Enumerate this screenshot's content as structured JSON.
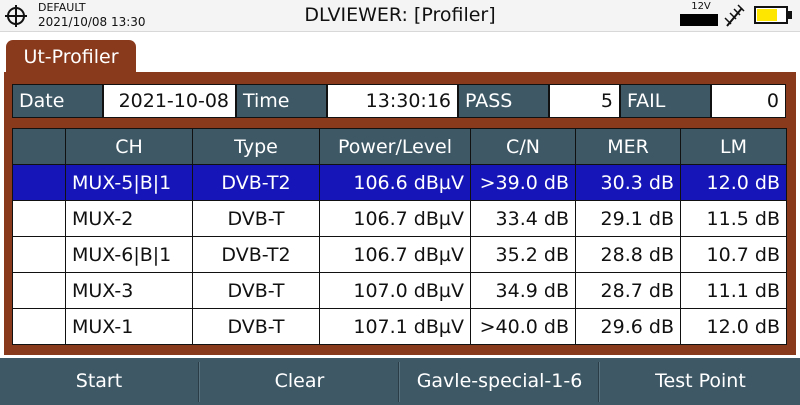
{
  "status": {
    "profile": "DEFAULT",
    "datetime": "2021/10/08 13:30",
    "title": "DLVIEWER: [Profiler]",
    "voltage": "12V",
    "icons": [
      "crosshair-icon",
      "antenna-icon",
      "battery-icon"
    ],
    "battery_level": 0.65
  },
  "tab": {
    "label": "Ut-Profiler"
  },
  "info": {
    "date_label": "Date",
    "date_value": "2021-10-08",
    "time_label": "Time",
    "time_value": "13:30:16",
    "pass_label": "PASS",
    "pass_value": "5",
    "fail_label": "FAIL",
    "fail_value": "0"
  },
  "table": {
    "headers": [
      "",
      "CH",
      "Type",
      "Power/Level",
      "C/N",
      "MER",
      "LM"
    ],
    "rows": [
      {
        "ch": "MUX-5|B|1",
        "type": "DVB-T2",
        "power": "106.6 dBµV",
        "cn": ">39.0 dB",
        "mer": "30.3 dB",
        "lm": "12.0 dB",
        "selected": true
      },
      {
        "ch": "MUX-2",
        "type": "DVB-T",
        "power": "106.7 dBµV",
        "cn": "33.4 dB",
        "mer": "29.1 dB",
        "lm": "11.5 dB",
        "selected": false
      },
      {
        "ch": "MUX-6|B|1",
        "type": "DVB-T2",
        "power": "106.7 dBµV",
        "cn": "35.2 dB",
        "mer": "28.8 dB",
        "lm": "10.7 dB",
        "selected": false
      },
      {
        "ch": "MUX-3",
        "type": "DVB-T",
        "power": "107.0 dBµV",
        "cn": "34.9 dB",
        "mer": "28.7 dB",
        "lm": "11.1 dB",
        "selected": false
      },
      {
        "ch": "MUX-1",
        "type": "DVB-T",
        "power": "107.1 dBµV",
        "cn": ">40.0 dB",
        "mer": "29.6 dB",
        "lm": "12.0 dB",
        "selected": false
      }
    ]
  },
  "softkeys": {
    "start": "Start",
    "clear": "Clear",
    "preset": "Gavle-special-1-6",
    "test_point": "Test Point"
  },
  "colors": {
    "panel": "#8a3a1c",
    "header": "#3e5866",
    "selected_row": "#1515b8",
    "battery": "#ffe600"
  }
}
